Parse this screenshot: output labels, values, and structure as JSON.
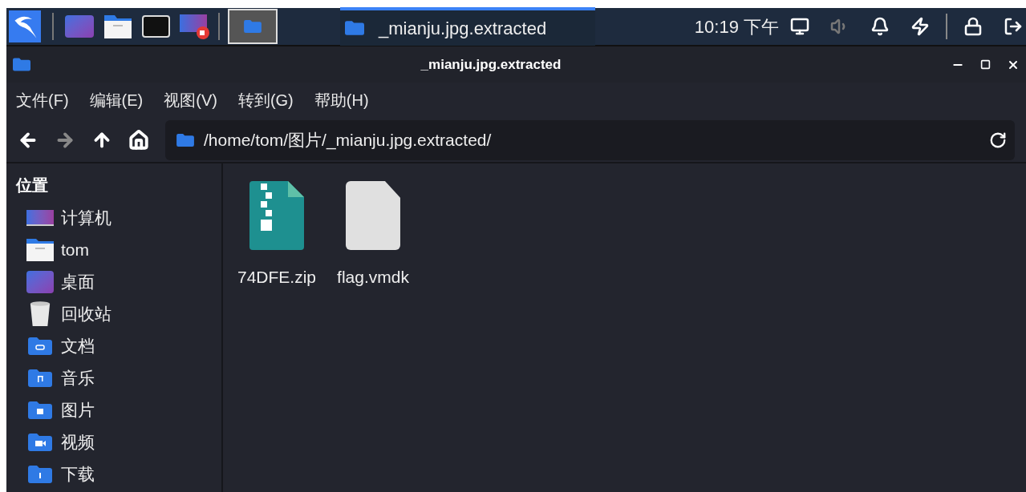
{
  "taskbar": {
    "launchers": [
      {
        "kind": "desktop"
      },
      {
        "kind": "files"
      },
      {
        "kind": "terminal"
      },
      {
        "kind": "recorder"
      }
    ],
    "workspaces": [
      {
        "selected": true
      }
    ],
    "tasks": [
      {
        "title": "_mianju.jpg.extracted",
        "selected": true
      }
    ],
    "clock": "10:19 下午",
    "tray": [
      {
        "kind": "display"
      },
      {
        "kind": "volume",
        "disabled": true
      },
      {
        "kind": "bell"
      },
      {
        "kind": "power"
      },
      {
        "kind": "lock"
      },
      {
        "kind": "logout"
      }
    ]
  },
  "window": {
    "title": "_mianju.jpg.extracted"
  },
  "menu": [
    "文件(F)",
    "编辑(E)",
    "视图(V)",
    "转到(G)",
    "帮助(H)"
  ],
  "nav": [
    {
      "kind": "back",
      "disabled": false
    },
    {
      "kind": "forward",
      "disabled": true
    },
    {
      "kind": "up",
      "disabled": false
    },
    {
      "kind": "home",
      "disabled": false
    }
  ],
  "path": "/home/tom/图片/_mianju.jpg.extracted/",
  "sidebar": {
    "heading": "位置",
    "items": [
      {
        "label": "计算机",
        "kind": "computer"
      },
      {
        "label": "tom",
        "kind": "home"
      },
      {
        "label": "桌面",
        "kind": "desktop"
      },
      {
        "label": "回收站",
        "kind": "trash"
      },
      {
        "label": "文档",
        "kind": "documents"
      },
      {
        "label": "音乐",
        "kind": "music"
      },
      {
        "label": "图片",
        "kind": "pictures"
      },
      {
        "label": "视频",
        "kind": "videos"
      },
      {
        "label": "下载",
        "kind": "downloads"
      }
    ]
  },
  "files": [
    {
      "name": "74DFE.zip",
      "kind": "zip"
    },
    {
      "name": "flag.vmdk",
      "kind": "binary"
    }
  ]
}
